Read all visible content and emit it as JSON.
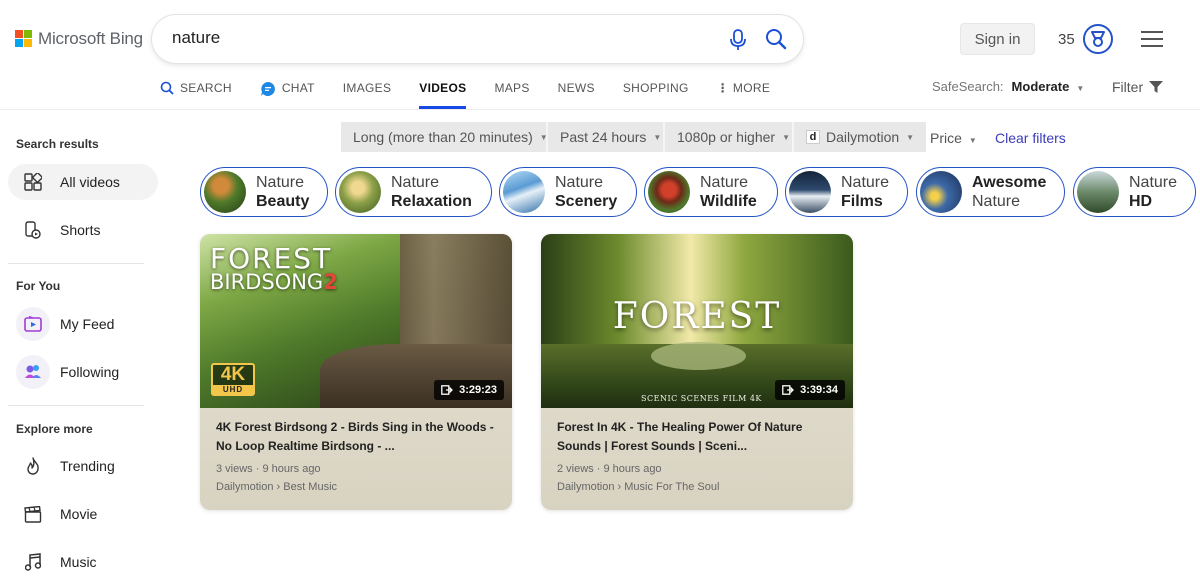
{
  "brand": {
    "name": "Microsoft Bing",
    "colors": [
      "#f25022",
      "#7fba00",
      "#00a4ef",
      "#ffb900"
    ]
  },
  "search": {
    "query": "nature",
    "mic_icon": "microphone-icon",
    "search_icon": "magnifier-icon"
  },
  "header": {
    "sign_in": "Sign in",
    "points": "35",
    "rewards_icon": "rewards-medal-icon",
    "menu_icon": "hamburger-menu-icon"
  },
  "tabs": [
    {
      "label": "SEARCH",
      "icon": "search-icon"
    },
    {
      "label": "CHAT",
      "icon": "copilot-chat-icon"
    },
    {
      "label": "IMAGES"
    },
    {
      "label": "VIDEOS",
      "active": true
    },
    {
      "label": "MAPS"
    },
    {
      "label": "NEWS"
    },
    {
      "label": "SHOPPING"
    },
    {
      "label": "MORE",
      "icon": "more-vertical-icon"
    }
  ],
  "safesearch": {
    "label": "SafeSearch:",
    "value": "Moderate"
  },
  "filter_label": "Filter",
  "accent_color": "#174ae4",
  "sidebar": {
    "search_results": "Search results",
    "items": [
      {
        "label": "All videos",
        "icon": "grid-icon",
        "active": true
      },
      {
        "label": "Shorts",
        "icon": "shorts-icon"
      }
    ],
    "for_you": "For You",
    "for_you_items": [
      {
        "label": "My Feed",
        "icon": "feed-icon"
      },
      {
        "label": "Following",
        "icon": "following-icon"
      }
    ],
    "explore_more": "Explore more",
    "explore_items": [
      {
        "label": "Trending",
        "icon": "flame-icon"
      },
      {
        "label": "Movie",
        "icon": "clapperboard-icon"
      },
      {
        "label": "Music",
        "icon": "music-note-icon"
      }
    ]
  },
  "filters": {
    "length": "Long (more than 20 minutes)",
    "date": "Past 24 hours",
    "resolution": "1080p or higher",
    "source": "Dailymotion",
    "source_badge": "d",
    "price": "Price",
    "clear": "Clear filters"
  },
  "related": [
    {
      "line1": "Nature",
      "line2": "Beauty"
    },
    {
      "line1": "Nature",
      "line2": "Relaxation"
    },
    {
      "line1": "Nature",
      "line2": "Scenery"
    },
    {
      "line1": "Nature",
      "line2": "Wildlife"
    },
    {
      "line1": "Nature",
      "line2": "Films"
    },
    {
      "line1": "Awesome",
      "line2": "Nature"
    },
    {
      "line1": "Nature",
      "line2": "HD"
    }
  ],
  "videos": [
    {
      "thumb_title": "FOREST",
      "thumb_subtitle": "BIRDSONG",
      "thumb_number": "2",
      "thumb_badge": "4K",
      "thumb_badge_sub": "UHD",
      "duration": "3:29:23",
      "title": "4K Forest Birdsong 2 - Birds Sing in the Woods - No Loop Realtime Birdsong - ...",
      "meta": "3 views · 9 hours ago",
      "source": "Dailymotion › Best Music"
    },
    {
      "thumb_title": "FOREST",
      "thumb_caption": "SCENIC SCENES FILM 4K",
      "duration": "3:39:34",
      "title": "Forest In 4K - The Healing Power Of Nature Sounds | Forest Sounds | Sceni...",
      "meta": "2 views · 9 hours ago",
      "source": "Dailymotion › Music For The Soul"
    }
  ]
}
